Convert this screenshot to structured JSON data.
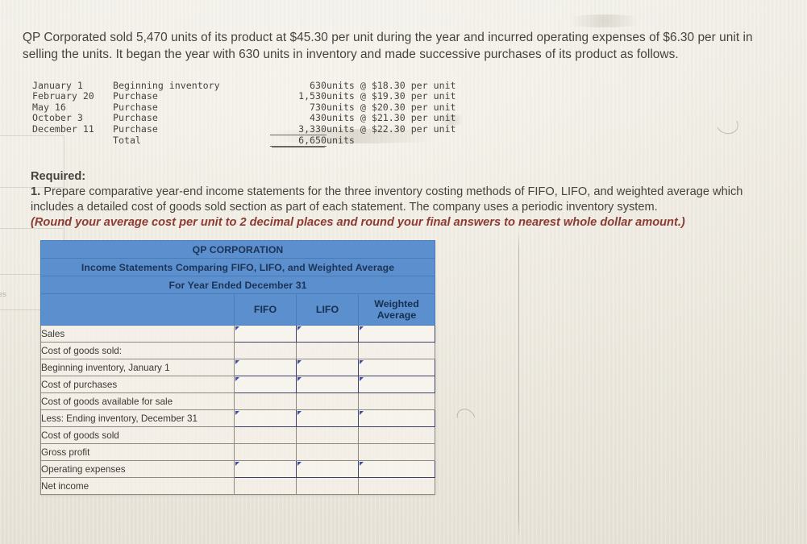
{
  "intro": {
    "text": "QP Corporated sold 5,470 units of its product at $45.30 per unit during the year and incurred operating expenses of $6.30 per unit in selling the units. It began the year with 630 units in inventory and made successive purchases of its product as follows."
  },
  "purchases": {
    "rows": [
      {
        "date": "January 1",
        "desc": "Beginning inventory",
        "units": "630",
        "rest": "units @ $18.30 per unit"
      },
      {
        "date": "February 20",
        "desc": "Purchase",
        "units": "1,530",
        "rest": "units @ $19.30 per unit"
      },
      {
        "date": "May 16",
        "desc": "Purchase",
        "units": "730",
        "rest": "units @ $20.30 per unit"
      },
      {
        "date": "October 3",
        "desc": "Purchase",
        "units": "430",
        "rest": "units @ $21.30 per unit"
      },
      {
        "date": "December 11",
        "desc": "Purchase",
        "units": "3,330",
        "rest": "units @ $22.30 per unit"
      }
    ],
    "total": {
      "label": "Total",
      "units": "6,650",
      "rest": "units"
    }
  },
  "required": {
    "heading": "Required:",
    "number": "1.",
    "body": " Prepare comparative year-end income statements for the three inventory costing methods of FIFO, LIFO, and weighted average which includes a detailed cost of goods sold section as part of each statement. The company uses a periodic inventory system.",
    "note": "(Round your average cost per unit to 2 decimal places and round your final answers to nearest whole dollar amount.)"
  },
  "answer_table": {
    "title_lines": [
      "QP CORPORATION",
      "Income Statements Comparing FIFO, LIFO, and Weighted Average",
      "For Year Ended December 31"
    ],
    "column_headers": [
      "FIFO",
      "LIFO",
      "Weighted Average"
    ],
    "rows": [
      {
        "label": "Sales",
        "indent": 0,
        "editable": true,
        "values": [
          "",
          "",
          ""
        ]
      },
      {
        "label": "Cost of goods sold:",
        "indent": 0,
        "editable": false,
        "values": [
          "",
          "",
          ""
        ]
      },
      {
        "label": "Beginning inventory, January 1",
        "indent": 1,
        "editable": true,
        "values": [
          "",
          "",
          ""
        ]
      },
      {
        "label": "Cost of purchases",
        "indent": 1,
        "editable": true,
        "values": [
          "",
          "",
          ""
        ]
      },
      {
        "label": "Cost of goods available for sale",
        "indent": 1,
        "editable": false,
        "values": [
          "",
          "",
          ""
        ]
      },
      {
        "label": "Less: Ending inventory, December 31",
        "indent": 2,
        "editable": true,
        "values": [
          "",
          "",
          ""
        ]
      },
      {
        "label": "Cost of goods sold",
        "indent": 3,
        "editable": false,
        "values": [
          "",
          "",
          ""
        ]
      },
      {
        "label": "Gross profit",
        "indent": 0,
        "editable": false,
        "values": [
          "",
          "",
          ""
        ]
      },
      {
        "label": "Operating expenses",
        "indent": 0,
        "editable": true,
        "values": [
          "",
          "",
          ""
        ]
      },
      {
        "label": "Net income",
        "indent": 0,
        "editable": false,
        "values": [
          "",
          "",
          ""
        ]
      }
    ]
  },
  "artifacts": {
    "edge_text": "es"
  },
  "colors": {
    "header_blue": "#5b8fce",
    "header_text": "#1c3355",
    "note_red": "#8c3b32",
    "page_bg": "#eae6dc",
    "input_border": "#3f3f6b",
    "marker_blue": "#3b4fa8"
  }
}
